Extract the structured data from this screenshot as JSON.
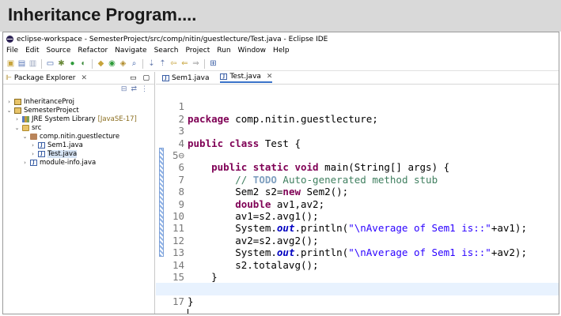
{
  "slide": {
    "title": "Inheritance Program...."
  },
  "window": {
    "title": "eclipse-workspace - SemesterProject/src/comp/nitin/guestlecture/Test.java - Eclipse IDE"
  },
  "menu": [
    "File",
    "Edit",
    "Source",
    "Refactor",
    "Navigate",
    "Search",
    "Project",
    "Run",
    "Window",
    "Help"
  ],
  "explorer": {
    "tab_label": "Package Explorer",
    "tree": [
      {
        "label": "InheritanceProj",
        "arrow": "›",
        "icon": "project-icon"
      },
      {
        "label": "SemesterProject",
        "arrow": "⌄",
        "icon": "project-icon"
      },
      {
        "label": "JRE System Library",
        "version": "[JavaSE-17]",
        "arrow": "›",
        "icon": "library-icon"
      },
      {
        "label": "src",
        "arrow": "⌄",
        "icon": "folder-icon"
      },
      {
        "label": "comp.nitin.guestlecture",
        "arrow": "⌄",
        "icon": "package-icon"
      },
      {
        "label": "Sem1.java",
        "arrow": "›",
        "icon": "java-file-icon"
      },
      {
        "label": "Test.java",
        "arrow": "›",
        "icon": "java-file-icon",
        "selected": true
      },
      {
        "label": "module-info.java",
        "arrow": "›",
        "icon": "java-file-icon"
      }
    ]
  },
  "editor": {
    "tabs": [
      {
        "label": "Sem1.java",
        "active": false
      },
      {
        "label": "Test.java",
        "active": true
      }
    ],
    "line_numbers": [
      "1",
      "2",
      "3",
      "4",
      "5⊖",
      "6",
      "7",
      "8",
      "9",
      "10",
      "11",
      "12",
      "13",
      "14",
      "15",
      "16",
      "17"
    ],
    "code": {
      "l1_kw": "package",
      "l1_rest": " comp.nitin.guestlecture;",
      "l3_kw1": "public",
      "l3_kw2": "class",
      "l3_rest": " Test {",
      "l5_indent": "    ",
      "l5_kw1": "public",
      "l5_kw2": "static",
      "l5_kw3": "void",
      "l5_rest": " main(String[] args) {",
      "l6_indent": "        ",
      "l6_cm1": "// ",
      "l6_todo": "TODO",
      "l6_cm2": " Auto-generated method stub",
      "l7_pre": "        Sem2 s2=",
      "l7_kw": "new",
      "l7_post": " Sem2();",
      "l8_indent": "        ",
      "l8_kw": "double",
      "l8_rest": " av1,av2;",
      "l9": "        av1=s2.avg1();",
      "l10_pre": "        System.",
      "l10_fld": "out",
      "l10_mid": ".println(",
      "l10_str": "\"\\nAverage of Sem1 is::\"",
      "l10_post": "+av1);",
      "l11": "        av2=s2.avg2();",
      "l12_pre": "        System.",
      "l12_fld": "out",
      "l12_mid": ".println(",
      "l12_str": "\"\\nAverage of Sem1 is::\"",
      "l12_post": "+av2);",
      "l13": "        s2.totalavg();",
      "l14": "    }",
      "l16": "}"
    }
  }
}
